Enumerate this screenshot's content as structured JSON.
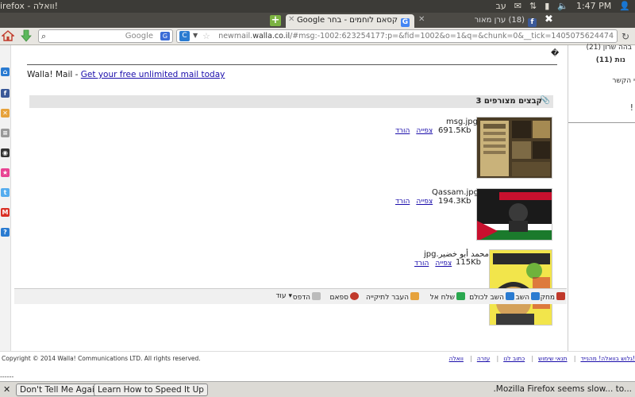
{
  "system_bar": {
    "window_title": "irefox - וואלה!",
    "keyboard_layout": "עב",
    "time": "1:47 PM"
  },
  "tabs": [
    {
      "label": "(18) ערן מאור",
      "favicon": "facebook-icon",
      "active": false
    },
    {
      "label": "קסאם לוחמים - בחר Google",
      "favicon": "google-icon",
      "active": true
    }
  ],
  "navbar": {
    "search_placeholder": "Google",
    "url_prefix": "newmail.",
    "url_domain": "walla.co.il",
    "url_rest": "/#msg:-1002:623254177:p=&fid=1002&o=1&q=&chunk=0&__tick=1405075624474"
  },
  "message": {
    "top_mark": "�",
    "walla_text": "Walla! Mail - ",
    "walla_link": "Get your free unlimited mail today",
    "attachments_header": "3 קבצים מצורפים",
    "attachments": [
      {
        "name": "msg.jpg",
        "size": "691.5Kb",
        "download": "הורד",
        "view": "צפייה",
        "palette": [
          "#6b5a3a",
          "#c9b27a",
          "#2d2418"
        ]
      },
      {
        "name": "Qassam.jpg",
        "size": "194.3Kb",
        "download": "הורד",
        "view": "צפייה",
        "palette": [
          "#1a1a1a",
          "#c8102e",
          "#1b7a2c"
        ]
      },
      {
        "name": "محمد أبو خضير.jpg",
        "size": "115Kb",
        "download": "הורד",
        "view": "צפייה",
        "palette": [
          "#f2e54b",
          "#2b2b2b",
          "#d4a15a"
        ]
      }
    ]
  },
  "actions": [
    {
      "label": "מחק",
      "color": "#c0392b"
    },
    {
      "label": "השב",
      "color": "#2a7bd1"
    },
    {
      "label": "השב לכולם",
      "color": "#2a7bd1"
    },
    {
      "label": "שלח אל",
      "color": "#2aa84f"
    },
    {
      "label": "העבר לתיקייה",
      "color": "#e6a23c"
    },
    {
      "label": "ספאם",
      "color": "#c0392b"
    },
    {
      "label": "הדפס",
      "color": "#777777"
    },
    {
      "label": "עוד",
      "color": ""
    }
  ],
  "right_column": {
    "line1": "בהה שרון (21)",
    "line2": "נות (11)",
    "line3": "י הקשר",
    "line4": "!"
  },
  "footer": {
    "copyright": "Copyright © 2014 Walla! Communications LTD. All rights reserved.",
    "links": [
      "גלוש בוואלה! מהנייד",
      "תנאי שימוש",
      "כתוב לנו",
      "עזרה",
      "וואלה!"
    ],
    "dashes": "------"
  },
  "notification": {
    "dont_tell": "Don't Tell Me Again",
    "learn": "Learn How to Speed It Up",
    "message": ".Mozilla Firefox seems slow... to..."
  }
}
